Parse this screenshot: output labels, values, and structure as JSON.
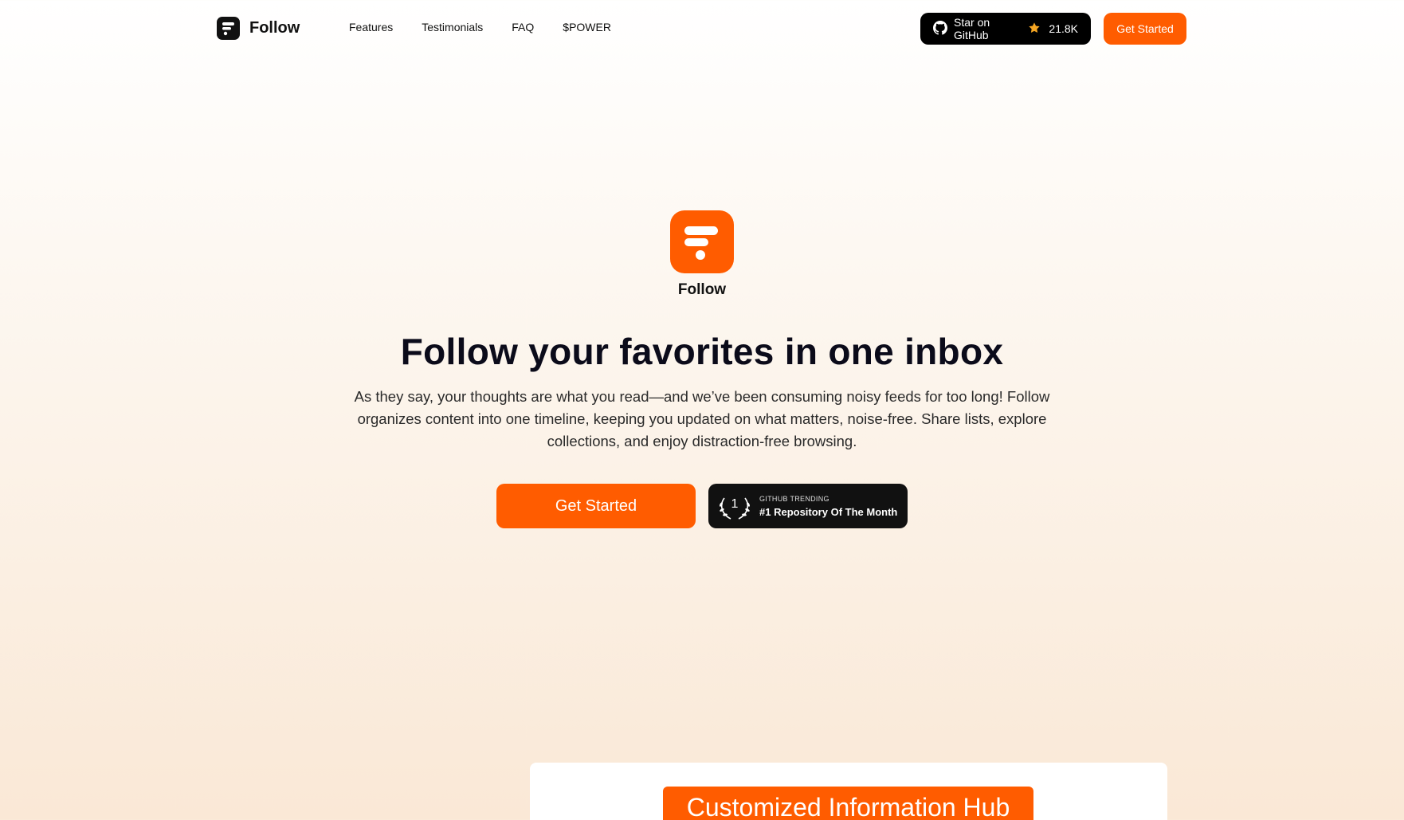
{
  "nav": {
    "brand": "Follow",
    "links": [
      "Features",
      "Testimonials",
      "FAQ",
      "$POWER"
    ],
    "github": {
      "label": "Star on GitHub",
      "count": "21.8K",
      "icon": "github-icon",
      "star_icon": "star-icon"
    },
    "cta": "Get Started"
  },
  "hero": {
    "app_name": "Follow",
    "title": "Follow your favorites in one inbox",
    "description": "As they say, your thoughts are what you read—and we’ve been consuming noisy feeds for too long! Follow organizes content into one timeline, keeping you updated on what matters, noise-free. Share lists, explore collections, and enjoy distraction-free browsing.",
    "cta": "Get Started",
    "badge": {
      "rank": "1",
      "small": "GITHUB TRENDING",
      "big": "#1 Repository Of The Month"
    }
  },
  "preview": {
    "pill": "Customized Information Hub"
  },
  "colors": {
    "accent": "#ff5c00",
    "dark": "#111111"
  }
}
